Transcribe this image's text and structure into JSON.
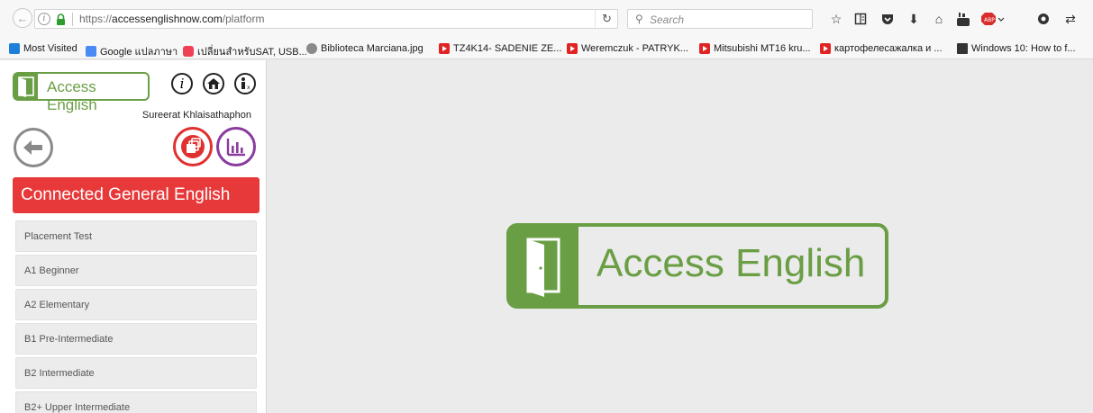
{
  "browser": {
    "url_prefix": "https://",
    "url_domain": "accessenglishnow.com",
    "url_path": "/platform",
    "search_placeholder": "Search",
    "bookmarks": [
      {
        "label": "Most Visited",
        "icon": "folder-icon"
      },
      {
        "label": "Google แปลภาษา",
        "icon": "google-translate-icon"
      },
      {
        "label": "เปลี่ยนสำหรับSAT, USB...",
        "icon": "pocket-icon"
      },
      {
        "label": "Biblioteca Marciana.jpg",
        "icon": "globe-icon"
      },
      {
        "label": "TZ4K14- SADENIE ZE...",
        "icon": "youtube-icon"
      },
      {
        "label": "Weremczuk - PATRYK...",
        "icon": "youtube-icon"
      },
      {
        "label": "Mitsubishi MT16 kru...",
        "icon": "youtube-icon"
      },
      {
        "label": "картофелесажалка и ...",
        "icon": "youtube-icon"
      },
      {
        "label": "Windows 10: How to f...",
        "icon": "ibt-icon"
      }
    ]
  },
  "sidebar": {
    "brand": "Access English",
    "user_name": "Sureerat Khlaisathaphon",
    "course_title": "Connected General English",
    "levels": [
      {
        "label": "Placement Test"
      },
      {
        "label": "A1 Beginner"
      },
      {
        "label": "A2 Elementary"
      },
      {
        "label": "B1 Pre-Intermediate"
      },
      {
        "label": "B2 Intermediate"
      },
      {
        "label": "B2+ Upper Intermediate"
      }
    ]
  },
  "main": {
    "brand": "Access English"
  },
  "colors": {
    "brand_green": "#6a9e44",
    "course_red": "#e8393a",
    "stats_purple": "#8a3b9e",
    "copies_red": "#e03030"
  }
}
